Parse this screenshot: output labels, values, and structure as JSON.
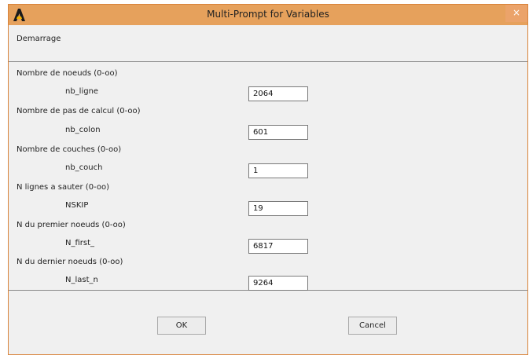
{
  "window": {
    "title": "Multi-Prompt for Variables",
    "close_glyph": "×",
    "title_color": "#e6a15c",
    "icon": "ansys-logo-icon"
  },
  "header": {
    "label": "Demarrage"
  },
  "variables": [
    {
      "description": "Nombre de noeuds (0-oo)",
      "name": "nb_ligne",
      "value": "2064"
    },
    {
      "description": "Nombre de pas de calcul (0-oo)",
      "name": "nb_colon",
      "value": "601"
    },
    {
      "description": "Nombre de couches (0-oo)",
      "name": "nb_couch",
      "value": "1"
    },
    {
      "description": "N lignes a sauter (0-oo)",
      "name": "NSKIP",
      "value": "19"
    },
    {
      "description": "N du premier noeuds (0-oo)",
      "name": "N_first_",
      "value": "6817"
    },
    {
      "description": "N du dernier noeuds (0-oo)",
      "name": "N_last_n",
      "value": "9264"
    }
  ],
  "buttons": {
    "ok": "OK",
    "cancel": "Cancel"
  }
}
